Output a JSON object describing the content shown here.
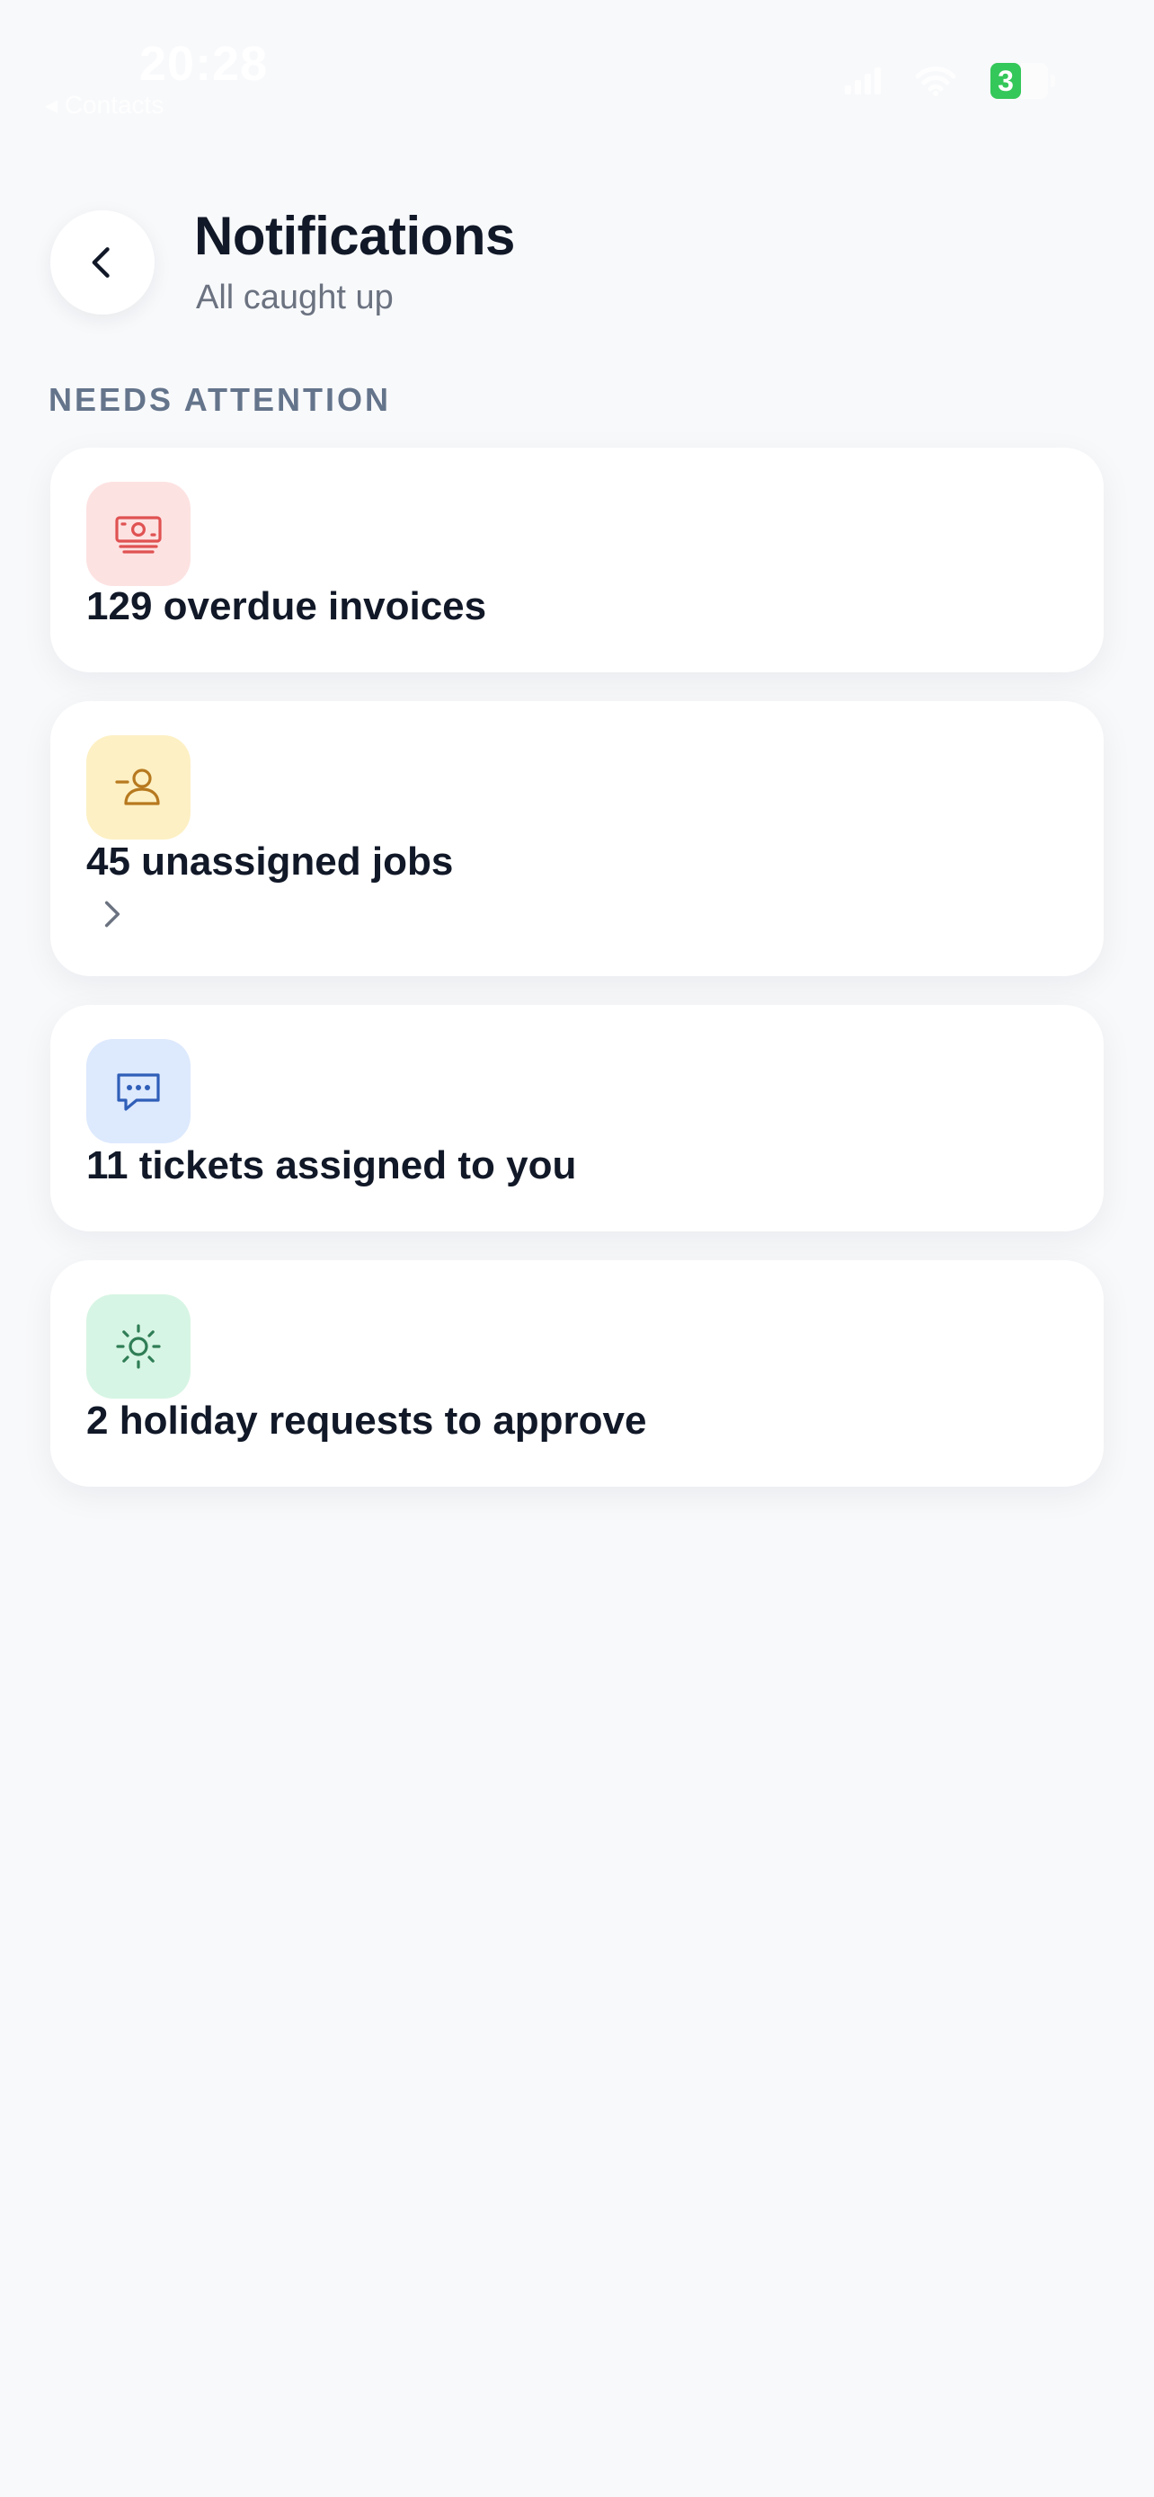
{
  "status_bar": {
    "time": "20:28",
    "back_app": "◂ Contacts",
    "battery_level": "3"
  },
  "header": {
    "title": "Notifications",
    "subtitle": "All caught up"
  },
  "section": {
    "label": "NEEDS ATTENTION"
  },
  "items": [
    {
      "label": "129 overdue invoices",
      "icon": "banknote-icon",
      "bg": "#fde2e2",
      "fg": "#e05252"
    },
    {
      "label": "45 unassigned jobs",
      "icon": "user-minus-icon",
      "bg": "#fdf0c4",
      "fg": "#b7791f"
    },
    {
      "label": "11 tickets assigned to you",
      "icon": "message-dots-icon",
      "bg": "#dde9fd",
      "fg": "#2f5fb8"
    },
    {
      "label": "2 holiday requests to approve",
      "icon": "sun-icon",
      "bg": "#d7f5e4",
      "fg": "#2f7d56"
    }
  ],
  "colors": {
    "background": "#f8f9fb",
    "card": "#ffffff",
    "title": "#111827",
    "muted": "#64748b"
  }
}
